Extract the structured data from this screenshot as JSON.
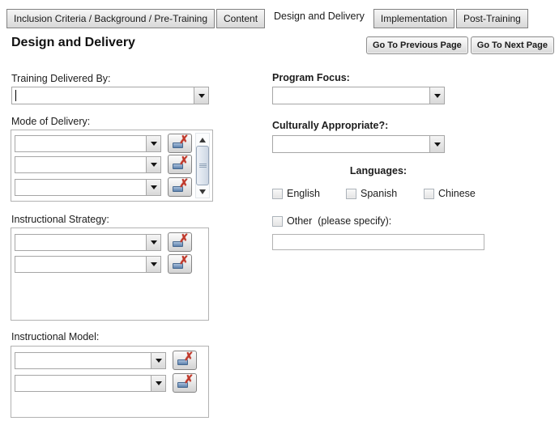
{
  "tabs": [
    {
      "label": "Inclusion Criteria / Background / Pre-Training",
      "active": false
    },
    {
      "label": "Content",
      "active": false
    },
    {
      "label": "Design and Delivery",
      "active": true
    },
    {
      "label": "Implementation",
      "active": false
    },
    {
      "label": "Post-Training",
      "active": false
    }
  ],
  "header": {
    "title": "Design and Delivery",
    "prev_button": "Go To Previous Page",
    "next_button": "Go To Next Page"
  },
  "left": {
    "training_delivered_by": {
      "label": "Training Delivered By:",
      "value": ""
    },
    "mode_of_delivery": {
      "label": "Mode of Delivery:",
      "row_count": 3,
      "row_values": [
        "",
        "",
        ""
      ]
    },
    "instructional_strategy": {
      "label": "Instructional Strategy:",
      "row_count": 2,
      "row_values": [
        "",
        ""
      ]
    },
    "instructional_model": {
      "label": "Instructional Model:",
      "row_count": 2,
      "row_values": [
        "",
        ""
      ]
    }
  },
  "right": {
    "program_focus": {
      "label": "Program Focus:",
      "value": ""
    },
    "culturally_appropriate": {
      "label": "Culturally Appropriate?:",
      "value": ""
    },
    "languages": {
      "heading": "Languages:",
      "options": [
        {
          "label": "English",
          "checked": false
        },
        {
          "label": "Spanish",
          "checked": false
        },
        {
          "label": "Chinese",
          "checked": false
        }
      ],
      "other": {
        "label": "Other  (please specify):",
        "checked": false,
        "value": ""
      }
    }
  },
  "icons": {
    "dropdown_arrow": "chevron-down-icon",
    "delete_row": "delete-record-icon",
    "scroll_up": "scroll-up-arrow-icon",
    "scroll_down": "scroll-down-arrow-icon"
  },
  "colors": {
    "background": "#ffffff",
    "tab_face": "#e0e0e0",
    "tab_border": "#828282",
    "control_border": "#a6a6a6",
    "group_border": "#b2b2b2",
    "text": "#1c1c1c",
    "delete_x_red": "#c0392b",
    "delete_sheet_blue": "#5d82ad",
    "scrollbar_thumb": "#cdd7e4"
  }
}
